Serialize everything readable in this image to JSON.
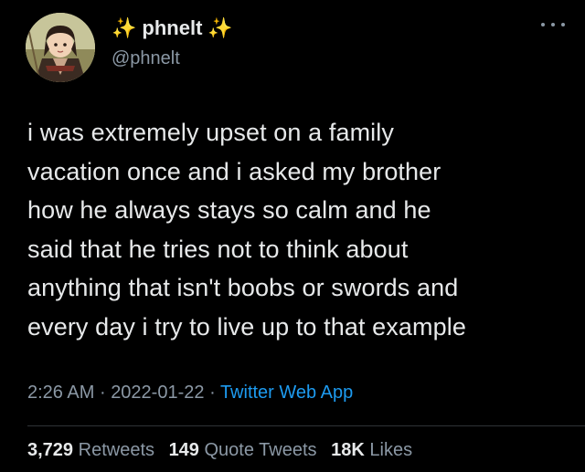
{
  "author": {
    "display_name": "phnelt",
    "decoration": "✨",
    "handle": "@phnelt",
    "avatar_icon": "anime-character-avatar"
  },
  "more_icon": "more-options-icon",
  "tweet": {
    "lines": [
      "i was extremely upset on a family",
      "vacation once and i asked my brother",
      "how he always stays so calm and he",
      "said that he tries not to think about",
      "anything that isn't boobs or swords and",
      "every day i try to live up to that example"
    ]
  },
  "meta": {
    "time": "2:26 AM",
    "separator": "·",
    "date": "2022-01-22",
    "source": "Twitter Web App"
  },
  "stats": {
    "retweets_count": "3,729",
    "retweets_label": "Retweets",
    "quotes_count": "149",
    "quotes_label": "Quote Tweets",
    "likes_count": "18K",
    "likes_label": "Likes"
  },
  "colors": {
    "background": "#000000",
    "text": "#e7e9ea",
    "secondary": "#8b98a5",
    "link": "#1d9bf0"
  }
}
